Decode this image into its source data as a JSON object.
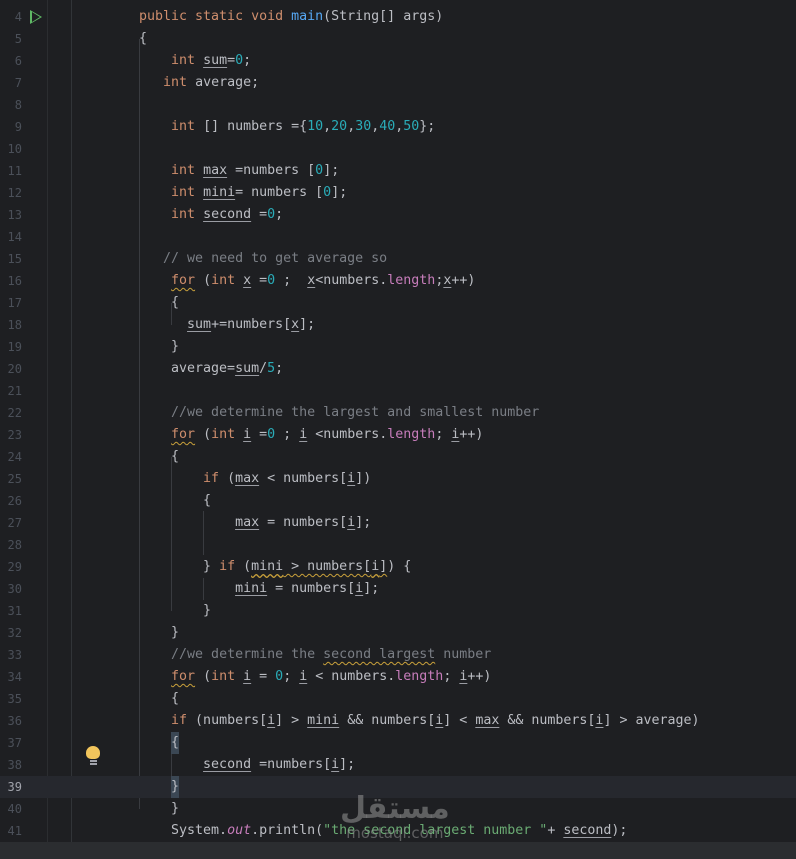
{
  "editor": {
    "current_line": 39,
    "lines": [
      {
        "n": 4,
        "t": [
          [
            "public static void ",
            "k"
          ],
          [
            "main",
            "f"
          ],
          [
            "(String[] args)",
            ""
          ]
        ]
      },
      {
        "n": 5,
        "t": [
          [
            "{",
            ""
          ]
        ]
      },
      {
        "n": 6,
        "t": [
          [
            "    ",
            ""
          ],
          [
            "int",
            "k"
          ],
          [
            " ",
            ""
          ],
          [
            "sum",
            "u"
          ],
          [
            "=",
            ""
          ],
          [
            "0",
            "n"
          ],
          [
            ";",
            ""
          ]
        ]
      },
      {
        "n": 7,
        "t": [
          [
            "   ",
            ""
          ],
          [
            "int",
            "k"
          ],
          [
            " average;",
            ""
          ]
        ]
      },
      {
        "n": 8,
        "t": []
      },
      {
        "n": 9,
        "t": [
          [
            "    ",
            ""
          ],
          [
            "int",
            "k"
          ],
          [
            " [] numbers ={",
            ""
          ],
          [
            "10",
            "n"
          ],
          [
            ",",
            ""
          ],
          [
            "20",
            "n"
          ],
          [
            ",",
            ""
          ],
          [
            "30",
            "n"
          ],
          [
            ",",
            ""
          ],
          [
            "40",
            "n"
          ],
          [
            ",",
            ""
          ],
          [
            "50",
            "n"
          ],
          [
            "};",
            ""
          ]
        ]
      },
      {
        "n": 10,
        "t": []
      },
      {
        "n": 11,
        "t": [
          [
            "    ",
            ""
          ],
          [
            "int",
            "k"
          ],
          [
            " ",
            ""
          ],
          [
            "max",
            "u"
          ],
          [
            " =numbers [",
            ""
          ],
          [
            "0",
            "n"
          ],
          [
            "];",
            ""
          ]
        ]
      },
      {
        "n": 12,
        "t": [
          [
            "    ",
            ""
          ],
          [
            "int",
            "k"
          ],
          [
            " ",
            ""
          ],
          [
            "mini",
            "u"
          ],
          [
            "= numbers [",
            ""
          ],
          [
            "0",
            "n"
          ],
          [
            "];",
            ""
          ]
        ]
      },
      {
        "n": 13,
        "t": [
          [
            "    ",
            ""
          ],
          [
            "int",
            "k"
          ],
          [
            " ",
            ""
          ],
          [
            "second",
            "u"
          ],
          [
            " =",
            ""
          ],
          [
            "0",
            "n"
          ],
          [
            ";",
            ""
          ]
        ]
      },
      {
        "n": 14,
        "t": []
      },
      {
        "n": 15,
        "t": [
          [
            "   ",
            ""
          ],
          [
            "// we need to get average so",
            "c"
          ]
        ]
      },
      {
        "n": 16,
        "t": [
          [
            "    ",
            ""
          ],
          [
            "for",
            "k w"
          ],
          [
            " (",
            ""
          ],
          [
            "int",
            "k"
          ],
          [
            " ",
            ""
          ],
          [
            "x",
            "u"
          ],
          [
            " =",
            ""
          ],
          [
            "0",
            "n"
          ],
          [
            " ;  ",
            ""
          ],
          [
            "x",
            "u"
          ],
          [
            "<numbers.",
            ""
          ],
          [
            "length",
            "p"
          ],
          [
            ";",
            ""
          ],
          [
            "x",
            "u"
          ],
          [
            "++)",
            ""
          ]
        ]
      },
      {
        "n": 17,
        "t": [
          [
            "    {",
            ""
          ]
        ]
      },
      {
        "n": 18,
        "t": [
          [
            "      ",
            ""
          ],
          [
            "sum",
            "u"
          ],
          [
            "+=numbers[",
            ""
          ],
          [
            "x",
            "u"
          ],
          [
            "];",
            ""
          ]
        ]
      },
      {
        "n": 19,
        "t": [
          [
            "    }",
            ""
          ]
        ]
      },
      {
        "n": 20,
        "t": [
          [
            "    average=",
            ""
          ],
          [
            "sum",
            "u"
          ],
          [
            "/",
            ""
          ],
          [
            "5",
            "n"
          ],
          [
            ";",
            ""
          ]
        ]
      },
      {
        "n": 21,
        "t": []
      },
      {
        "n": 22,
        "t": [
          [
            "    ",
            ""
          ],
          [
            "//we determine the largest and smallest number",
            "c"
          ]
        ]
      },
      {
        "n": 23,
        "t": [
          [
            "    ",
            ""
          ],
          [
            "for",
            "k w"
          ],
          [
            " (",
            ""
          ],
          [
            "int",
            "k"
          ],
          [
            " ",
            ""
          ],
          [
            "i",
            "u"
          ],
          [
            " =",
            ""
          ],
          [
            "0",
            "n"
          ],
          [
            " ; ",
            ""
          ],
          [
            "i",
            "u"
          ],
          [
            " <numbers.",
            ""
          ],
          [
            "length",
            "p"
          ],
          [
            "; ",
            ""
          ],
          [
            "i",
            "u"
          ],
          [
            "++)",
            ""
          ]
        ]
      },
      {
        "n": 24,
        "t": [
          [
            "    {",
            ""
          ]
        ]
      },
      {
        "n": 25,
        "t": [
          [
            "        ",
            ""
          ],
          [
            "if",
            "k"
          ],
          [
            " (",
            ""
          ],
          [
            "max",
            "u"
          ],
          [
            " < numbers[",
            ""
          ],
          [
            "i",
            "u"
          ],
          [
            "])",
            ""
          ]
        ]
      },
      {
        "n": 26,
        "t": [
          [
            "        {",
            ""
          ]
        ]
      },
      {
        "n": 27,
        "t": [
          [
            "            ",
            ""
          ],
          [
            "max",
            "u"
          ],
          [
            " = numbers[",
            ""
          ],
          [
            "i",
            "u"
          ],
          [
            "];",
            ""
          ]
        ]
      },
      {
        "n": 28,
        "t": []
      },
      {
        "n": 29,
        "t": [
          [
            "        } ",
            ""
          ],
          [
            "if",
            "k"
          ],
          [
            " (",
            ""
          ],
          [
            "mini",
            "u w"
          ],
          [
            " > numbers[",
            "w"
          ],
          [
            "i",
            "u w"
          ],
          [
            "]",
            "w"
          ],
          [
            ") {",
            ""
          ]
        ]
      },
      {
        "n": 30,
        "t": [
          [
            "            ",
            ""
          ],
          [
            "mini",
            "u"
          ],
          [
            " = numbers[",
            ""
          ],
          [
            "i",
            "u"
          ],
          [
            "];",
            ""
          ]
        ]
      },
      {
        "n": 31,
        "t": [
          [
            "        }",
            ""
          ]
        ]
      },
      {
        "n": 32,
        "t": [
          [
            "    }",
            ""
          ]
        ]
      },
      {
        "n": 33,
        "t": [
          [
            "    ",
            ""
          ],
          [
            "//we determine the ",
            "c"
          ],
          [
            "second largest",
            "c w"
          ],
          [
            " number",
            "c"
          ]
        ]
      },
      {
        "n": 34,
        "t": [
          [
            "    ",
            ""
          ],
          [
            "for",
            "k w"
          ],
          [
            " (",
            ""
          ],
          [
            "int",
            "k"
          ],
          [
            " ",
            ""
          ],
          [
            "i",
            "u"
          ],
          [
            " = ",
            ""
          ],
          [
            "0",
            "n"
          ],
          [
            "; ",
            ""
          ],
          [
            "i",
            "u"
          ],
          [
            " < numbers.",
            ""
          ],
          [
            "length",
            "p"
          ],
          [
            "; ",
            ""
          ],
          [
            "i",
            "u"
          ],
          [
            "++)",
            ""
          ]
        ]
      },
      {
        "n": 35,
        "t": [
          [
            "    {",
            ""
          ]
        ]
      },
      {
        "n": 36,
        "t": [
          [
            "    ",
            ""
          ],
          [
            "if",
            "k"
          ],
          [
            " (numbers[",
            ""
          ],
          [
            "i",
            "u"
          ],
          [
            "] > ",
            ""
          ],
          [
            "mini",
            "u"
          ],
          [
            " && numbers[",
            ""
          ],
          [
            "i",
            "u"
          ],
          [
            "] < ",
            ""
          ],
          [
            "max",
            "u"
          ],
          [
            " && numbers[",
            ""
          ],
          [
            "i",
            "u"
          ],
          [
            "] > average)",
            ""
          ]
        ]
      },
      {
        "n": 37,
        "t": [
          [
            "    ",
            ""
          ],
          [
            "{",
            "hl"
          ]
        ]
      },
      {
        "n": 38,
        "t": [
          [
            "        ",
            ""
          ],
          [
            "second",
            "u"
          ],
          [
            " =numbers[",
            ""
          ],
          [
            "i",
            "u"
          ],
          [
            "];",
            ""
          ]
        ]
      },
      {
        "n": 39,
        "t": [
          [
            "    ",
            ""
          ],
          [
            "}",
            "hl"
          ]
        ]
      },
      {
        "n": 40,
        "t": [
          [
            "    }",
            ""
          ]
        ]
      },
      {
        "n": 41,
        "t": [
          [
            "    System.",
            ""
          ],
          [
            "out",
            "pi"
          ],
          [
            ".println(",
            ""
          ],
          [
            "\"the second largest number \"",
            "s"
          ],
          [
            "+ ",
            ""
          ],
          [
            "second",
            "u"
          ],
          [
            ");",
            ""
          ]
        ]
      }
    ]
  },
  "gutter_icons": {
    "run": "run-icon",
    "intention": "lightbulb-icon"
  },
  "watermark": {
    "arabic": "مستقل",
    "latin": "mostaql.com"
  }
}
